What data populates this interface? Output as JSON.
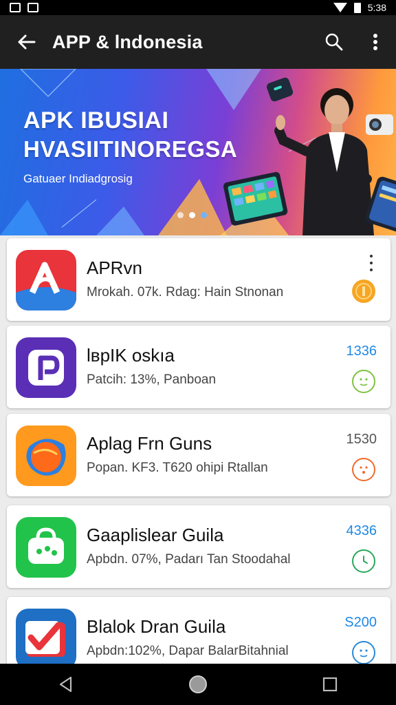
{
  "status_bar": {
    "time": "5:38"
  },
  "toolbar": {
    "title": "APP & lndonesia"
  },
  "banner": {
    "headline_1": "APK IBUSIAI",
    "headline_2": "HVASIITINOREGSA",
    "subtitle": "Gatuaer Indiadgrosig",
    "slide_count": 3,
    "active_slide": 2
  },
  "apps": [
    {
      "name": "APRvn",
      "meta": "Mrokah. 07k. Rdag: Hain Stnonan",
      "count": "",
      "icon": "red-a-icon",
      "status_icon": "coin-icon",
      "status_color": "#f5a623",
      "has_menu": true
    },
    {
      "name": "lвpIK oskıa",
      "meta": "Patcih: 13%, Panboan",
      "count": "1336",
      "icon": "purple-p-icon",
      "status_icon": "green-face-icon",
      "status_color": "#7dc242",
      "count_color": "#1e88e5"
    },
    {
      "name": "Aplag Frn Guns",
      "meta": "Popan. KF3. T620 ohipi Rtallan",
      "count": "1530",
      "icon": "orange-blob-icon",
      "status_icon": "orange-face-icon",
      "status_color": "#f06a2a",
      "count_color": "#555555"
    },
    {
      "name": "Gaaplislear Guila",
      "meta": "Apbdn. 07%, Padarı Tan Stoodahal",
      "count": "4336",
      "icon": "green-bag-icon",
      "status_icon": "green-clock-icon",
      "status_color": "#27a85a",
      "count_color": "#1e88e5"
    },
    {
      "name": "Blalok Dran Guila",
      "meta": "Apbdn:102%, Dapar BalarBitahnial",
      "count": "S200",
      "icon": "blue-check-icon",
      "status_icon": "blue-face-icon",
      "status_color": "#2a8ad8",
      "count_color": "#1e88e5"
    }
  ],
  "nav": {
    "back": "back-icon",
    "home": "home-icon",
    "recents": "recents-icon"
  }
}
